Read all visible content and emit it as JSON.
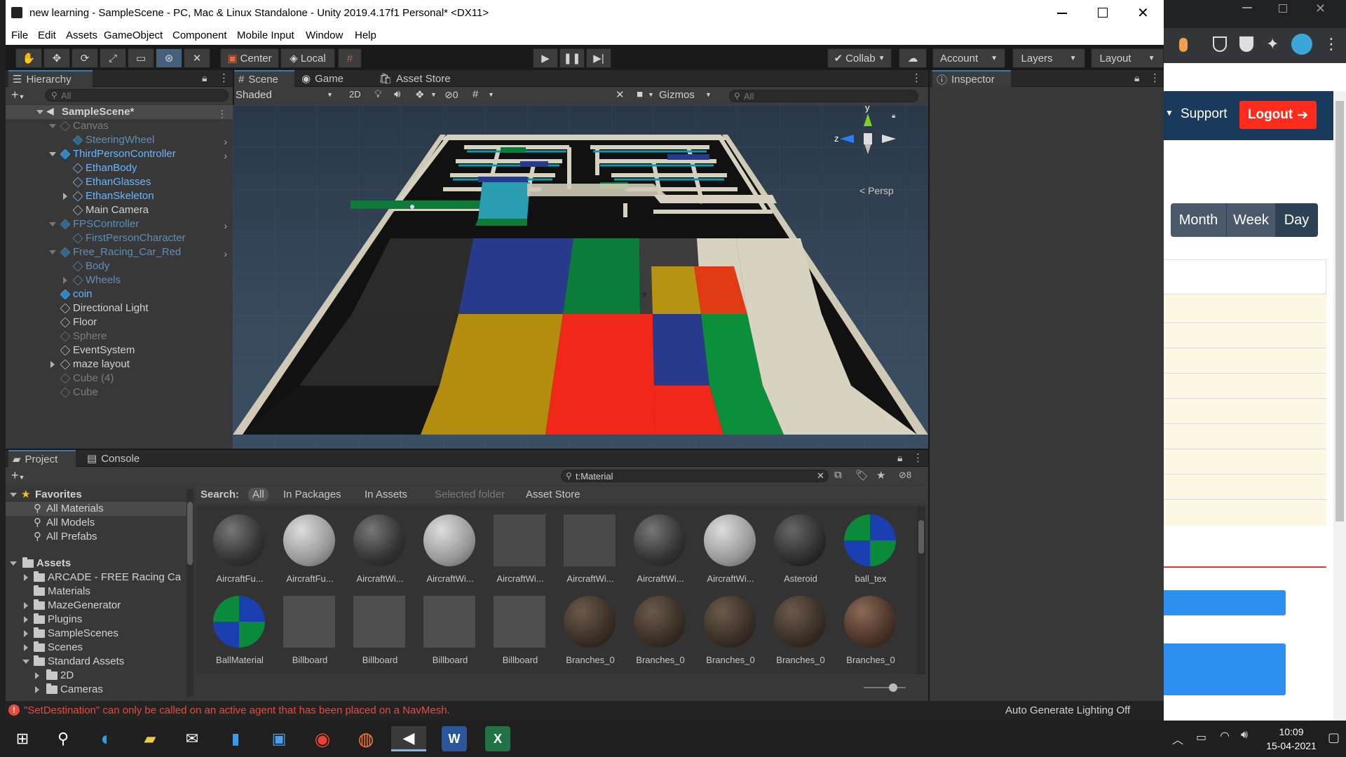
{
  "window": {
    "title": "new learning - SampleScene - PC, Mac & Linux Standalone - Unity 2019.4.17f1 Personal* <DX11>"
  },
  "menu": [
    "File",
    "Edit",
    "Assets",
    "GameObject",
    "Component",
    "Mobile Input",
    "Window",
    "Help"
  ],
  "toolbar": {
    "center_label": "Center",
    "local_label": "Local",
    "collab_label": "Collab",
    "account_label": "Account",
    "layers_label": "Layers",
    "layout_label": "Layout"
  },
  "hierarchy": {
    "tab_label": "Hierarchy",
    "search_placeholder": "All",
    "items": [
      {
        "label": "SampleScene*"
      },
      {
        "label": "Canvas"
      },
      {
        "label": "SteeringWheel"
      },
      {
        "label": "ThirdPersonController"
      },
      {
        "label": "EthanBody"
      },
      {
        "label": "EthanGlasses"
      },
      {
        "label": "EthanSkeleton"
      },
      {
        "label": "Main Camera"
      },
      {
        "label": "FPSController"
      },
      {
        "label": "FirstPersonCharacter"
      },
      {
        "label": "Free_Racing_Car_Red"
      },
      {
        "label": "Body"
      },
      {
        "label": "Wheels"
      },
      {
        "label": "coin"
      },
      {
        "label": "Directional Light"
      },
      {
        "label": "Floor"
      },
      {
        "label": "Sphere"
      },
      {
        "label": "EventSystem"
      },
      {
        "label": "maze layout"
      },
      {
        "label": "Cube (4)"
      },
      {
        "label": "Cube"
      }
    ]
  },
  "scene": {
    "tabs": [
      "Scene",
      "Game",
      "Asset Store"
    ],
    "shading": "Shaded",
    "mode_2d": "2D",
    "hidden_count": "0",
    "gizmos_label": "Gizmos",
    "search_placeholder": "All",
    "persp_label": "< Persp",
    "axis_y": "y",
    "axis_z": "z"
  },
  "inspector": {
    "tab_label": "Inspector"
  },
  "project": {
    "tabs": [
      "Project",
      "Console"
    ],
    "search_value": "t:Material",
    "hidden_count": "8",
    "search_label": "Search:",
    "filters": [
      "All",
      "In Packages",
      "In Assets",
      "Selected folder",
      "Asset Store"
    ],
    "favorites_label": "Favorites",
    "favorites": [
      "All Materials",
      "All Models",
      "All Prefabs"
    ],
    "assets_label": "Assets",
    "folders": [
      "ARCADE - FREE Racing Ca",
      "Materials",
      "MazeGenerator",
      "Plugins",
      "SampleScenes",
      "Scenes",
      "Standard Assets",
      "2D",
      "Cameras"
    ],
    "assets_row1": [
      "AircraftFu...",
      "AircraftFu...",
      "AircraftWi...",
      "AircraftWi...",
      "AircraftWi...",
      "AircraftWi...",
      "AircraftWi...",
      "AircraftWi...",
      "Asteroid",
      "ball_tex"
    ],
    "assets_row2": [
      "BallMaterial",
      "Billboard",
      "Billboard",
      "Billboard",
      "Billboard",
      "Branches_0",
      "Branches_0",
      "Branches_0",
      "Branches_0",
      "Branches_0"
    ]
  },
  "status": {
    "error": "\"SetDestination\" can only be called on an active agent that has been placed on a NavMesh.",
    "lighting": "Auto Generate Lighting Off"
  },
  "browser": {
    "support": "Support",
    "logout": "Logout",
    "cal_buttons": [
      "Month",
      "Week",
      "Day"
    ]
  },
  "taskbar": {
    "time": "10:09",
    "date": "15-04-2021"
  }
}
